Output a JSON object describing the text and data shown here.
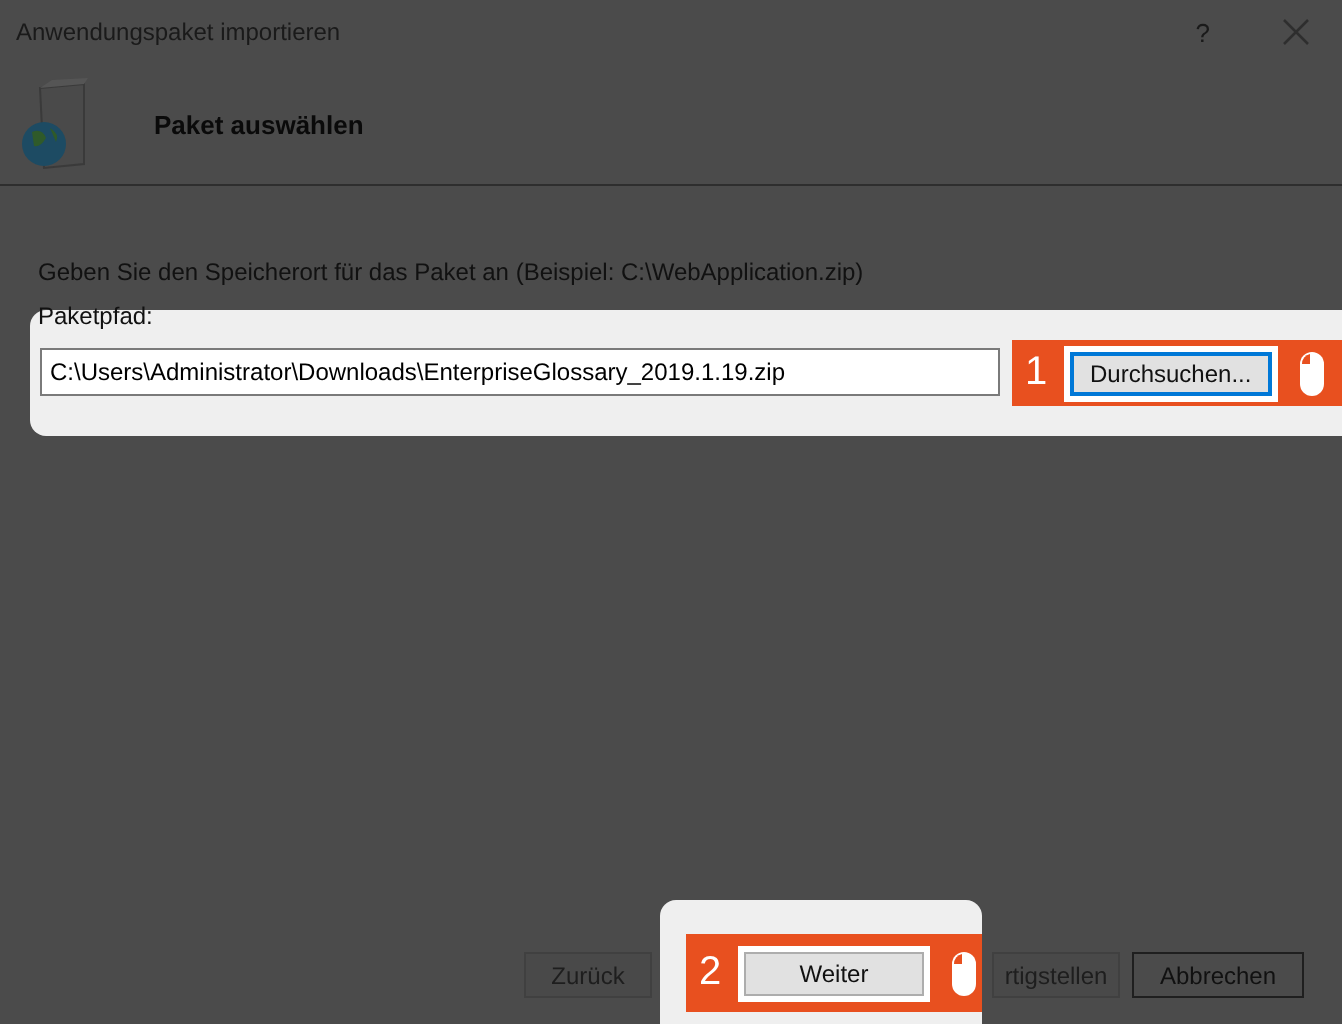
{
  "window": {
    "title": "Anwendungspaket importieren",
    "help": "?"
  },
  "header": {
    "title": "Paket auswählen"
  },
  "description": "Geben Sie den Speicherort für das Paket an (Beispiel: C:\\WebApplication.zip)",
  "path_field": {
    "label": "Paketpfad:",
    "value": "C:\\Users\\Administrator\\Downloads\\EnterpriseGlossary_2019.1.19.zip"
  },
  "callouts": [
    {
      "number": "1",
      "button": "Durchsuchen...",
      "focused": true
    },
    {
      "number": "2",
      "button": "Weiter",
      "focused": false
    }
  ],
  "buttons": [
    {
      "label": "Zurück",
      "disabled": true
    },
    {
      "label": "rtigstellen",
      "disabled": true
    },
    {
      "label": "Abbrechen",
      "disabled": false
    }
  ]
}
